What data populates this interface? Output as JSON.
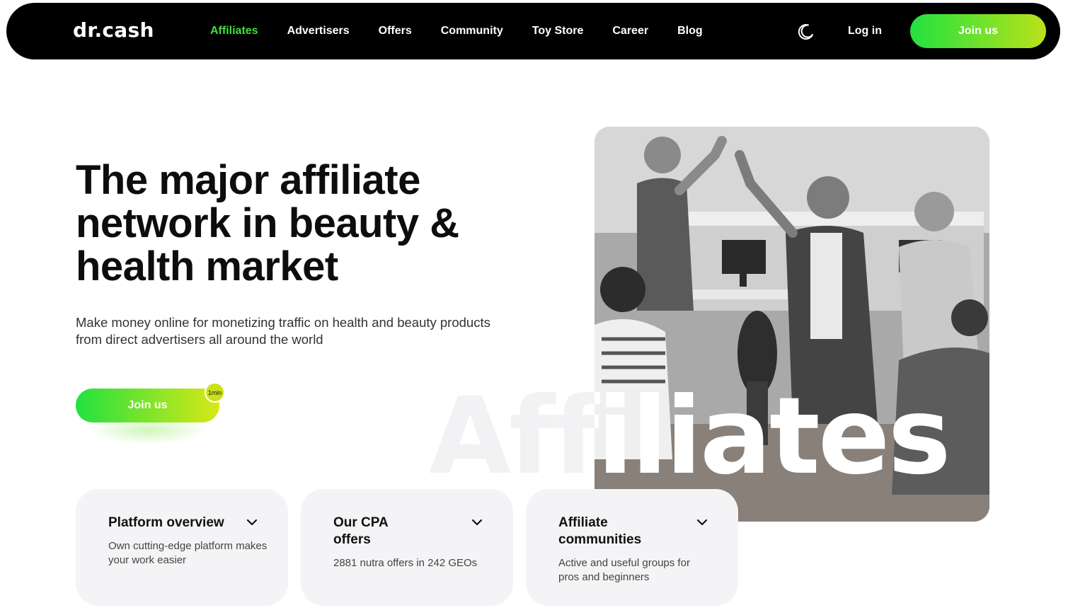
{
  "header": {
    "logo": "dr.cash",
    "nav": [
      {
        "label": "Affiliates",
        "active": true
      },
      {
        "label": "Advertisers",
        "active": false
      },
      {
        "label": "Offers",
        "active": false
      },
      {
        "label": "Community",
        "active": false
      },
      {
        "label": "Toy Store",
        "active": false
      },
      {
        "label": "Career",
        "active": false
      },
      {
        "label": "Blog",
        "active": false
      }
    ],
    "theme_icon": "moon-icon",
    "login_label": "Log in",
    "join_label": "Join us"
  },
  "hero": {
    "title": "The major affiliate network in beauty & health market",
    "subtitle": "Make money online for monetizing traffic on health and beauty products from direct advertisers all around the world",
    "join_label": "Join us",
    "badge": "1min",
    "watermark": "Affiliates"
  },
  "cards": [
    {
      "title": "Platform overview",
      "desc": "Own cutting-edge platform makes your work easier"
    },
    {
      "title": "Our CPA offers",
      "desc": "2881 nutra offers in 242 GEOs"
    },
    {
      "title": "Affiliate communities",
      "desc": "Active and useful groups for pros and beginners"
    }
  ],
  "colors": {
    "accent_green": "#3ee03a",
    "gradient_start": "#22e13f",
    "gradient_end": "#b9e21a",
    "card_bg": "#f4f4f6",
    "header_bg": "#000000"
  }
}
